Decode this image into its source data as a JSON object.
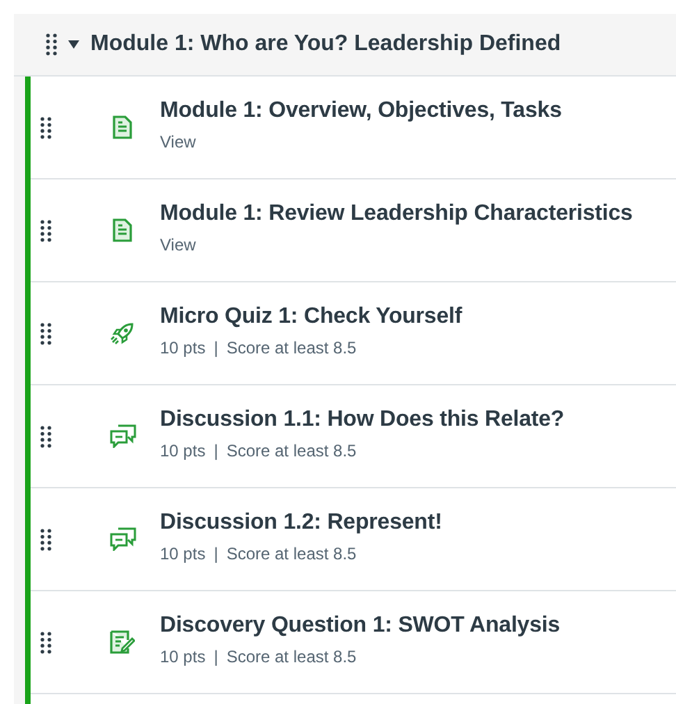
{
  "module": {
    "title": "Module 1: Who are You? Leadership Defined",
    "expanded": true
  },
  "items": [
    {
      "kind": "page",
      "title": "Module 1: Overview, Objectives, Tasks",
      "meta": [
        "View"
      ]
    },
    {
      "kind": "page",
      "title": "Module 1: Review Leadership Characteristics",
      "meta": [
        "View"
      ]
    },
    {
      "kind": "quiz",
      "title": "Micro Quiz 1: Check Yourself",
      "meta": [
        "10 pts",
        "|",
        "Score at least 8.5"
      ]
    },
    {
      "kind": "discussion",
      "title": "Discussion 1.1: How Does this Relate?",
      "meta": [
        "10 pts",
        "|",
        "Score at least 8.5"
      ]
    },
    {
      "kind": "discussion",
      "title": "Discussion 1.2: Represent!",
      "meta": [
        "10 pts",
        "|",
        "Score at least 8.5"
      ]
    },
    {
      "kind": "assignment",
      "title": "Discovery Question 1: SWOT Analysis",
      "meta": [
        "10 pts",
        "|",
        "Score at least 8.5"
      ]
    }
  ]
}
